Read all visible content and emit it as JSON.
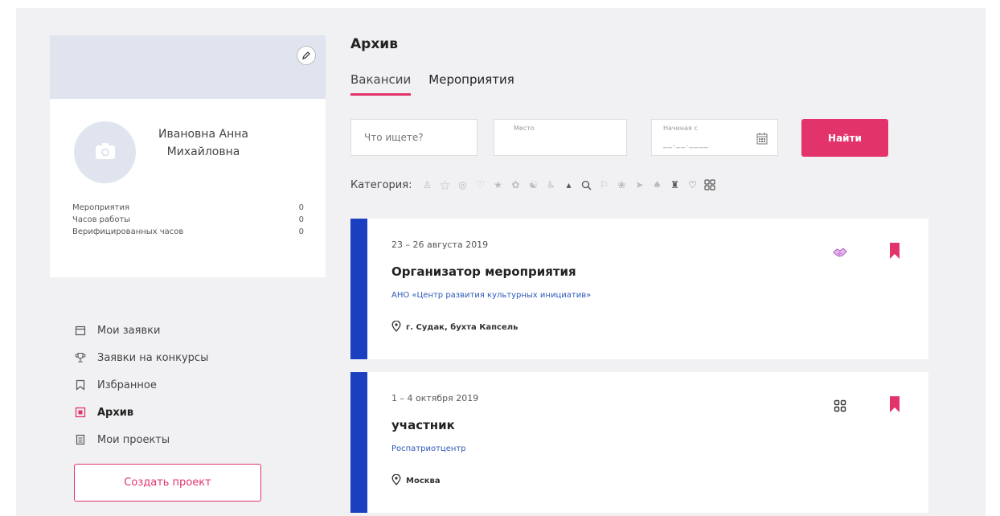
{
  "profile": {
    "name_line1": "Ивановна Анна",
    "name_line2": "Михайловна",
    "stats": [
      {
        "label": "Мероприятия",
        "value": "0"
      },
      {
        "label": "Часов работы",
        "value": "0"
      },
      {
        "label": "Верифицированных часов",
        "value": "0"
      }
    ]
  },
  "nav": {
    "items": [
      {
        "label": "Мои заявки",
        "icon": "calendar-icon"
      },
      {
        "label": "Заявки на конкурсы",
        "icon": "trophy-icon"
      },
      {
        "label": "Избранное",
        "icon": "bookmark-icon"
      },
      {
        "label": "Архив",
        "icon": "archive-icon",
        "active": true
      },
      {
        "label": "Мои проекты",
        "icon": "document-icon"
      }
    ],
    "create_label": "Создать проект"
  },
  "main": {
    "title": "Архив",
    "tabs": [
      {
        "label": "Вакансии",
        "active": true
      },
      {
        "label": "Мероприятия",
        "active": false
      }
    ],
    "search": {
      "query_placeholder": "Что ищете?",
      "place_label": "Место",
      "date_label": "Начиная с",
      "date_placeholder": "__.__.____",
      "find_label": "Найти"
    },
    "categories_label": "Категория:",
    "cards": [
      {
        "date": "23 – 26 августа 2019",
        "title": "Организатор мероприятия",
        "org": "АНО «Центр развития культурных инициатив»",
        "location": "г. Судак, бухта Капсель",
        "category_icon": "handshake-icon"
      },
      {
        "date": "1 – 4 октября 2019",
        "title": "участник",
        "org": "Роспатриотцентр",
        "location": "Москва",
        "category_icon": "grid-icon"
      }
    ]
  },
  "colors": {
    "accent": "#e2336b",
    "strip": "#1a3fc0",
    "link": "#2b5ab8",
    "cover": "#dfe4ef",
    "page_bg": "#f1f1f3"
  }
}
